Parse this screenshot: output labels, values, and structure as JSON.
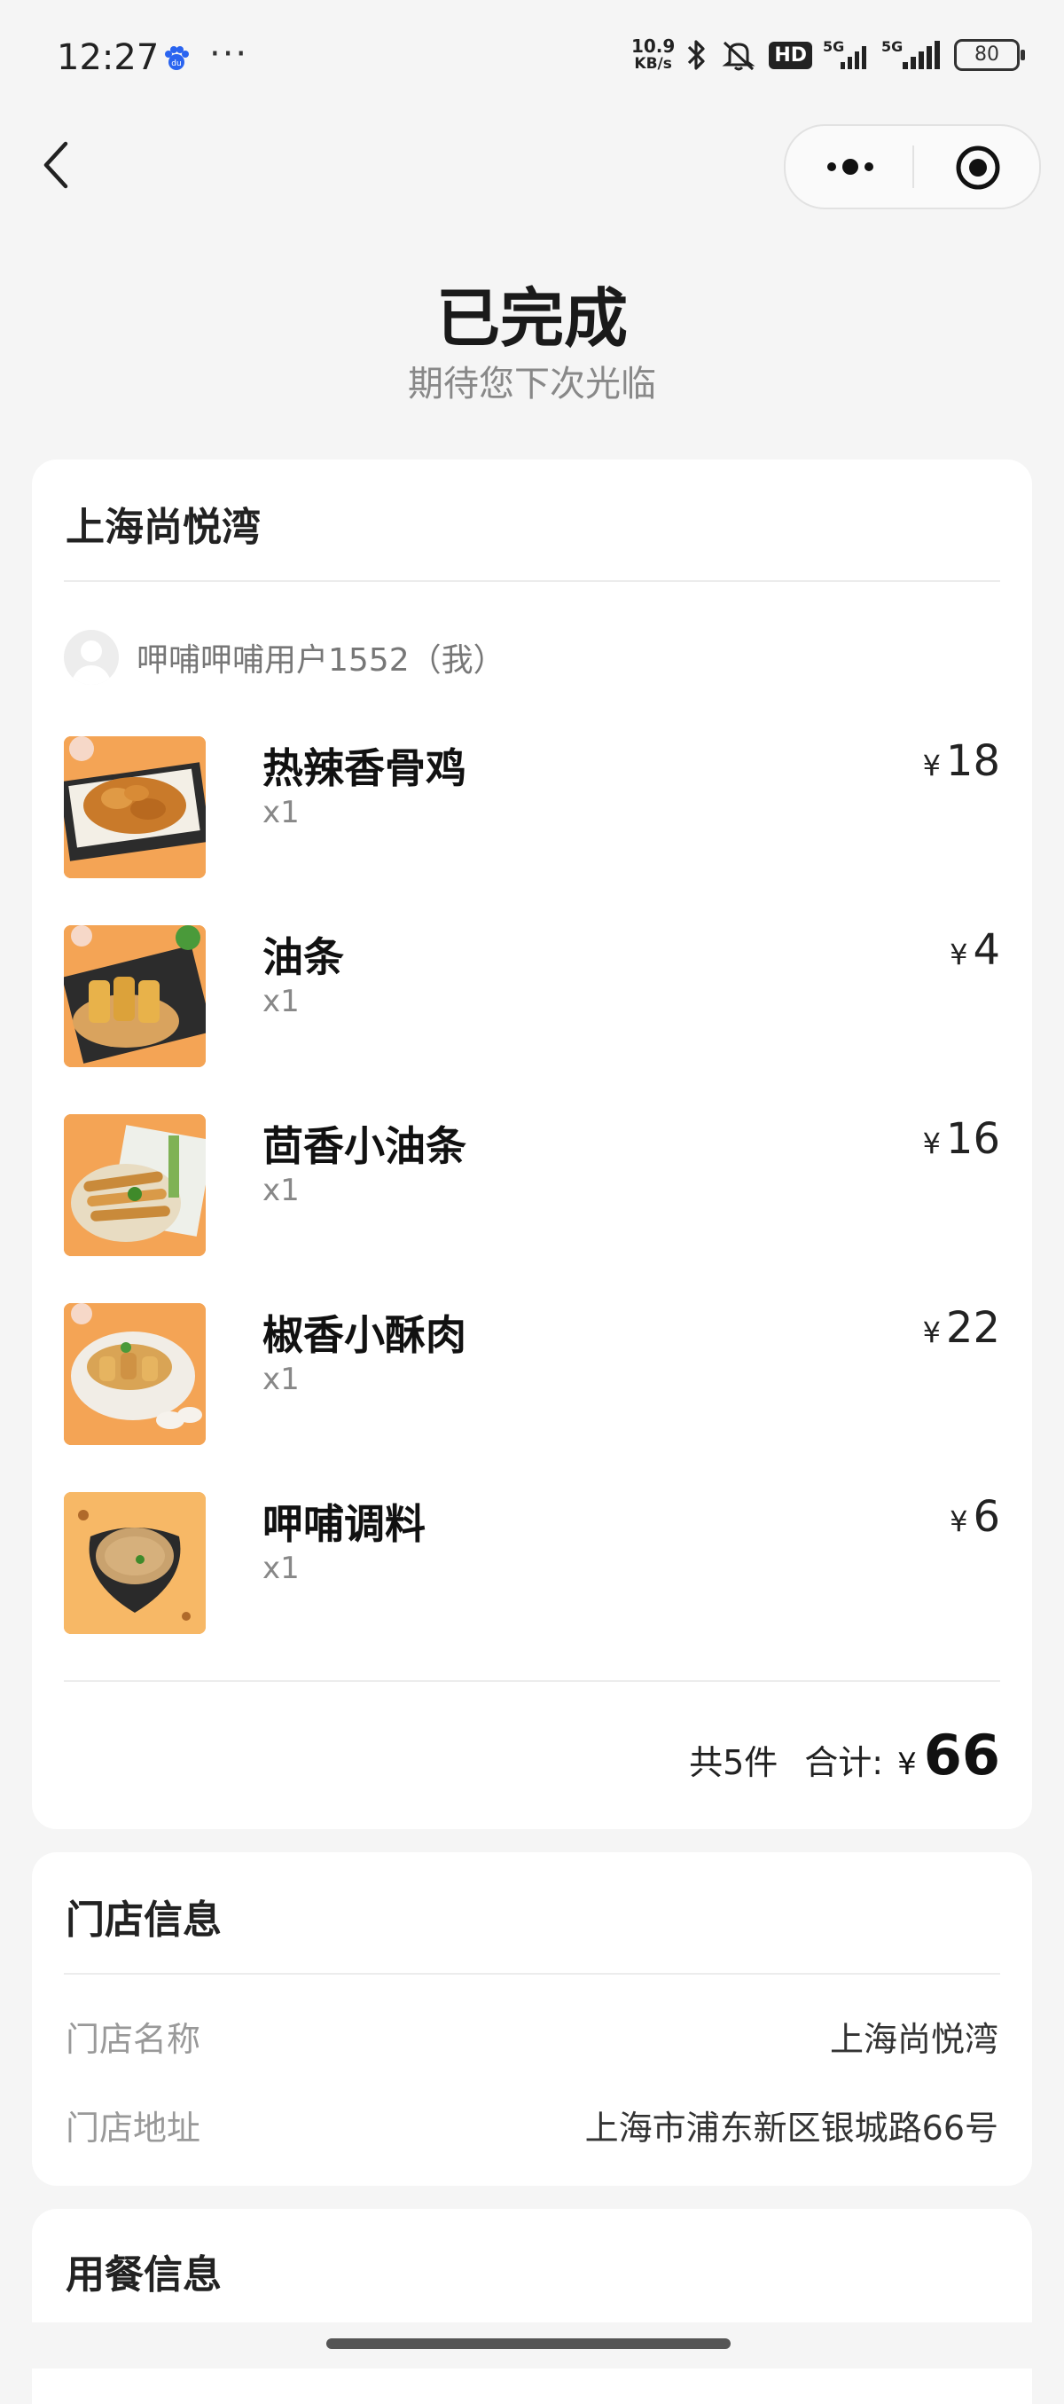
{
  "status_bar": {
    "time": "12:27",
    "more": "···",
    "net_speed_value": "10.9",
    "net_speed_unit": "KB/s",
    "hd_label": "HD",
    "sig1_label": "5G",
    "sig2_label": "5G",
    "battery": "80"
  },
  "order": {
    "status_title": "已完成",
    "status_subtitle": "期待您下次光临"
  },
  "store_card": {
    "store_name": "上海尚悦湾",
    "user_label": "呷哺呷哺用户1552（我）",
    "currency": "¥",
    "items": [
      {
        "name": "热辣香骨鸡",
        "qty": "x1",
        "price": "18",
        "image": "fried-chicken"
      },
      {
        "name": "油条",
        "qty": "x1",
        "price": "4",
        "image": "youtiao"
      },
      {
        "name": "茴香小油条",
        "qty": "x1",
        "price": "16",
        "image": "fennel-youtiao"
      },
      {
        "name": "椒香小酥肉",
        "qty": "x1",
        "price": "22",
        "image": "crispy-pork"
      },
      {
        "name": "呷哺调料",
        "qty": "x1",
        "price": "6",
        "image": "sauce"
      }
    ],
    "total_count": "共5件",
    "total_label": "合计:",
    "total_amount": "66"
  },
  "store_info": {
    "title": "门店信息",
    "name_label": "门店名称",
    "name_value": "上海尚悦湾",
    "address_label": "门店地址",
    "address_value": "上海市浦东新区银城路66号"
  },
  "dining_info": {
    "title": "用餐信息"
  },
  "colors": {
    "background": "#f5f5f5",
    "card": "#ffffff",
    "thumb_orange": "#f2a24e"
  }
}
